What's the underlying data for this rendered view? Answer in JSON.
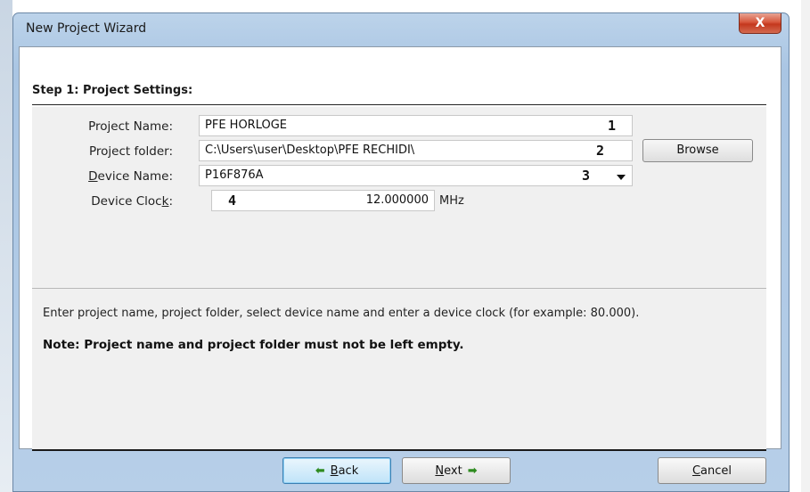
{
  "window": {
    "title": "New Project Wizard",
    "close_glyph": "X"
  },
  "step": {
    "title": "Step 1: Project Settings:"
  },
  "form": {
    "project_name": {
      "label": "Project Name:",
      "value": "PFE HORLOGE",
      "marker": "1"
    },
    "project_folder": {
      "label": "Project folder:",
      "value": "C:\\Users\\user\\Desktop\\PFE RECHIDI\\",
      "marker": "2",
      "browse_label": "Browse"
    },
    "device_name": {
      "label_prefix": "",
      "label_underlined": "D",
      "label_rest": "evice Name:",
      "value": "P16F876A",
      "marker": "3"
    },
    "device_clock": {
      "label_prefix": "Device Cloc",
      "label_underlined": "k",
      "label_rest": ":",
      "value": "12.000000",
      "unit": "MHz",
      "marker": "4"
    }
  },
  "info_text": "Enter project name, project folder, select device name and enter a device clock (for example: 80.000).",
  "note_text": "Note: Project name and project folder must not be left empty.",
  "buttons": {
    "back": {
      "underlined": "B",
      "rest": "ack",
      "icon": "green-left-arrow-icon"
    },
    "next": {
      "underlined": "N",
      "rest": "ext",
      "icon": "green-right-arrow-icon"
    },
    "cancel": {
      "underlined": "C",
      "rest": "ancel"
    }
  }
}
